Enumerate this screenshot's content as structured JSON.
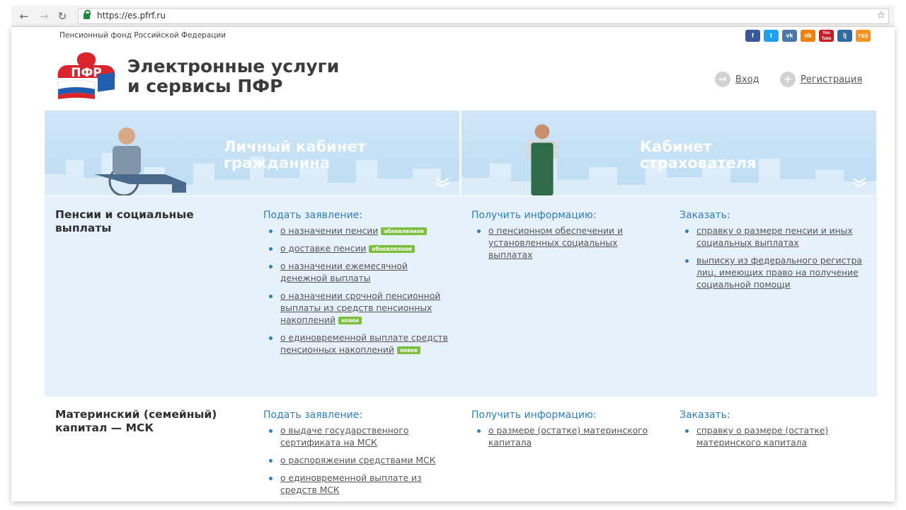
{
  "browser": {
    "url": "https://es.pfrf.ru"
  },
  "header": {
    "org_name": "Пенсионный фонд Российской Федерации",
    "logo_text": "ПФР",
    "title_line1": "Электронные услуги",
    "title_line2": "и сервисы ПФР",
    "login_label": "Вход",
    "register_label": "Регистрация"
  },
  "socials": [
    {
      "label": "f",
      "color": "#3b5998"
    },
    {
      "label": "t",
      "color": "#1da1f2"
    },
    {
      "label": "vk",
      "color": "#4a76a8"
    },
    {
      "label": "ok",
      "color": "#ee8208"
    },
    {
      "label": "You Tube",
      "color": "#cc181e"
    },
    {
      "label": "lj",
      "color": "#2f6aa3"
    },
    {
      "label": "rss",
      "color": "#f7931e"
    }
  ],
  "banners": {
    "citizen": {
      "line1": "Личный кабинет",
      "line2": "гражданина"
    },
    "insurer": {
      "line1": "Кабинет",
      "line2": "страхователя"
    }
  },
  "sections": [
    {
      "title_line1": "Пенсии и социальные",
      "title_line2": "выплаты",
      "apply": {
        "heading": "Подать заявление:",
        "items": [
          {
            "text": "о назначении пенсии",
            "badge": "обновленное"
          },
          {
            "text": "о доставке пенсии",
            "badge": "обновленное"
          },
          {
            "text": "о назначении ежемесячной денежной выплаты",
            "badge": ""
          },
          {
            "text": "о назначении срочной пенсионной выплаты из средств пенсионных накоплений",
            "badge": "новое"
          },
          {
            "text": "о единовременной выплате средств пенсионных накоплений",
            "badge": "новое"
          }
        ]
      },
      "info": {
        "heading": "Получить информацию:",
        "items": [
          {
            "text": "о пенсионном обеспечении и установленных социальных выплатах",
            "badge": ""
          }
        ]
      },
      "order": {
        "heading": "Заказать:",
        "items": [
          {
            "text": "справку о размере пенсии и иных социальных выплатах",
            "badge": ""
          },
          {
            "text": "выписку из федерального регистра лиц, имеющих право на получение социальной помощи",
            "badge": ""
          }
        ]
      }
    },
    {
      "title_line1": "Материнский (семейный)",
      "title_line2": "капитал — МСК",
      "apply": {
        "heading": "Подать заявление:",
        "items": [
          {
            "text": "о выдаче государственного сертификата на МСК",
            "badge": ""
          },
          {
            "text": "о распоряжении средствами МСК",
            "badge": ""
          },
          {
            "text": "о единовременной выплате из средств МСК",
            "badge": ""
          }
        ]
      },
      "info": {
        "heading": "Получить информацию:",
        "items": [
          {
            "text": "о размере (остатке) материнского капитала",
            "badge": ""
          }
        ]
      },
      "order": {
        "heading": "Заказать:",
        "items": [
          {
            "text": "справку о размере (остатке) материнского капитала",
            "badge": ""
          }
        ]
      }
    }
  ]
}
